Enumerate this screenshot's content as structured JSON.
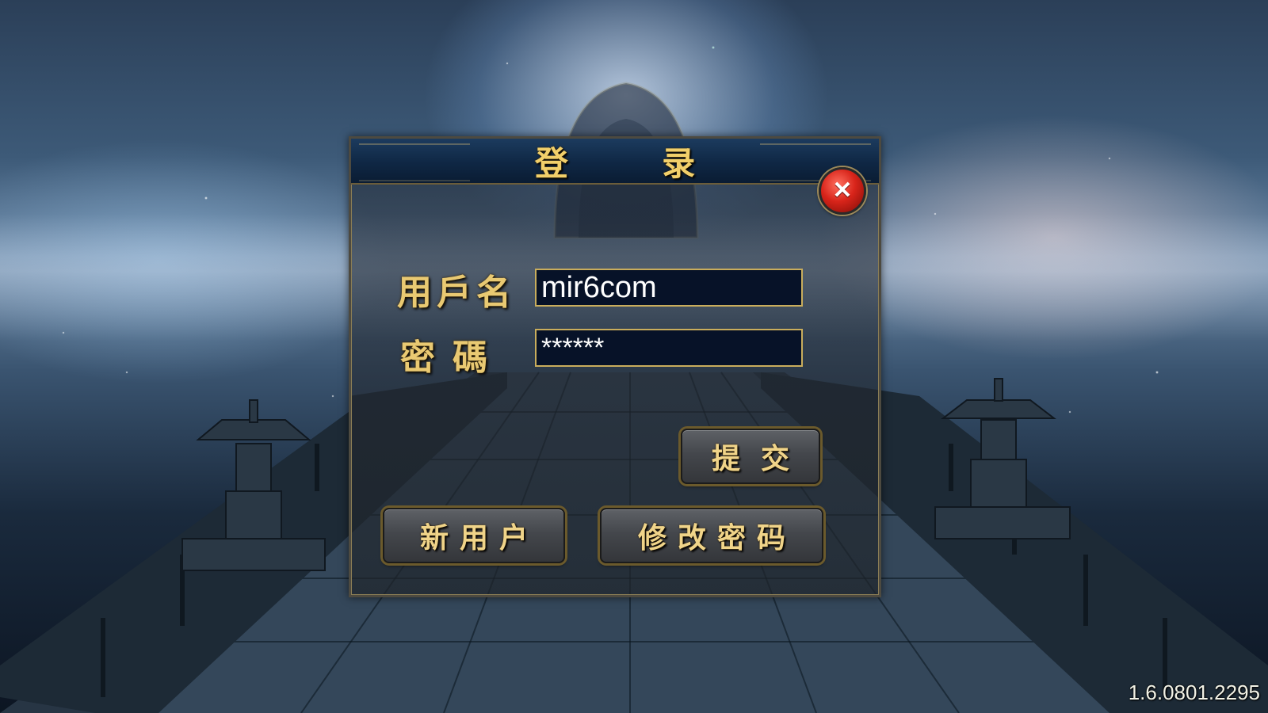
{
  "dialog": {
    "title": "登 录",
    "close_icon": "close-icon",
    "username_label": "用戶名",
    "username_value": "mir6com",
    "password_label": "密碼",
    "password_value": "******",
    "submit_label": "提交",
    "new_user_label": "新用户",
    "change_password_label": "修改密码"
  },
  "footer": {
    "version": "1.6.0801.2295"
  },
  "colors": {
    "label_gold": "#e9c972",
    "title_gold": "#f1cf6a",
    "input_bg": "#071228",
    "input_border": "#c9ad5c",
    "close_red": "#d8241a"
  }
}
